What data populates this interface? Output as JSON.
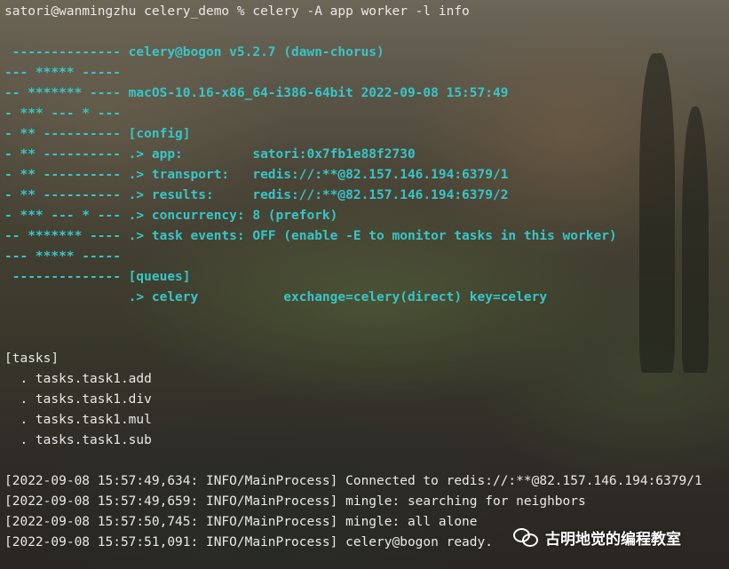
{
  "terminal": {
    "colors": {
      "text": "#e9e9e6",
      "cyan": "#37c6c8"
    },
    "lines": [
      "satori@wanmingzhu celery_demo % celery -A app worker -l info",
      "",
      " -------------- celery@bogon v5.2.7 (dawn-chorus)",
      "--- ***** -----",
      "-- ******* ---- macOS-10.16-x86_64-i386-64bit 2022-09-08 15:57:49",
      "- *** --- * ---",
      "- ** ---------- [config]",
      "- ** ---------- .> app:         satori:0x7fb1e88f2730",
      "- ** ---------- .> transport:   redis://:**@82.157.146.194:6379/1",
      "- ** ---------- .> results:     redis://:**@82.157.146.194:6379/2",
      "- *** --- * --- .> concurrency: 8 (prefork)",
      "-- ******* ---- .> task events: OFF (enable -E to monitor tasks in this worker)",
      "--- ***** -----",
      " -------------- [queues]",
      "                .> celery           exchange=celery(direct) key=celery",
      "",
      "",
      "[tasks]",
      "  . tasks.task1.add",
      "  . tasks.task1.div",
      "  . tasks.task1.mul",
      "  . tasks.task1.sub",
      "",
      "[2022-09-08 15:57:49,634: INFO/MainProcess] Connected to redis://:**@82.157.146.194:6379/1",
      "[2022-09-08 15:57:49,659: INFO/MainProcess] mingle: searching for neighbors",
      "[2022-09-08 15:57:50,745: INFO/MainProcess] mingle: all alone",
      "[2022-09-08 15:57:51,091: INFO/MainProcess] celery@bogon ready."
    ]
  },
  "watermark": {
    "icon": "wechat-icon",
    "text": "古明地觉的编程教室"
  }
}
